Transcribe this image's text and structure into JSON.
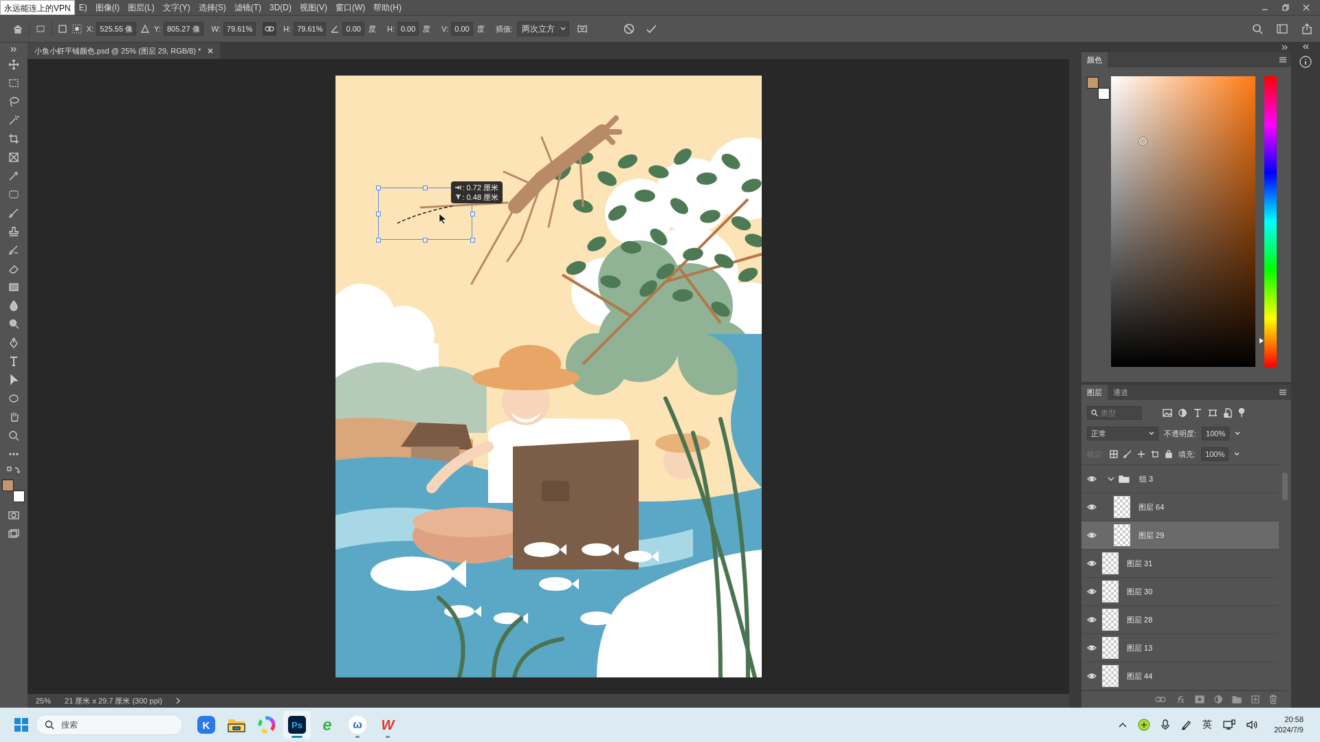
{
  "menu_bar": {
    "overlay_label": "永远能连上的VPN",
    "items": [
      "E)",
      "图像(I)",
      "图层(L)",
      "文字(Y)",
      "选择(S)",
      "滤镜(T)",
      "3D(D)",
      "视图(V)",
      "窗口(W)",
      "帮助(H)"
    ]
  },
  "options_bar": {
    "fields": [
      {
        "label": "X:",
        "value": "525.55 像"
      },
      {
        "label": "Y:",
        "value": "805.27 像"
      },
      {
        "label": "W:",
        "value": "79.61%"
      },
      {
        "label": "H:",
        "value": "79.61%"
      },
      {
        "value": "0.00",
        "unit": "度"
      },
      {
        "label": "H:",
        "value": "0.00",
        "unit": "度"
      },
      {
        "label": "V:",
        "value": "0.00",
        "unit": "度"
      }
    ],
    "proportions_linked": true,
    "interpolation": {
      "label": "插值:",
      "value": "两次立方"
    }
  },
  "document_tab": {
    "title": "小鱼小虾平铺颜色.psd @ 25% (图层 29, RGB/8) *",
    "selected": true
  },
  "canvas": {
    "measurements": [
      {
        "kind": "horizontal",
        "text": ": 0.72 厘米"
      },
      {
        "kind": "vertical",
        "text": ": 0.48 厘米"
      }
    ]
  },
  "status_bar": {
    "zoom": "25%",
    "document_size": "21 厘米 x 29.7 厘米 (300 ppi)"
  },
  "swatches": [
    {
      "kind": "foreground",
      "color": "#c4976f"
    },
    {
      "kind": "background",
      "color": "#ffffff"
    }
  ],
  "color_panel": {
    "title": "颜色",
    "hue": {
      "level": 0.09
    }
  },
  "layers_panel": {
    "tabs": [
      {
        "label": "图层",
        "selected": true
      },
      {
        "label": "通道",
        "selected": false
      }
    ],
    "filter_placeholder": "类型",
    "blend_mode": "正常",
    "opacity_label": "不透明度:",
    "opacity": "100%",
    "lock_label": "锁定:",
    "fill_label": "填充:",
    "fill": "100%",
    "layers": [
      {
        "name": "组 3",
        "kind": "group",
        "visible": true,
        "expanded": true,
        "selected": false,
        "children": [
          {
            "name": "图层 64",
            "kind": "layer",
            "visible": true,
            "selected": false
          },
          {
            "name": "图层 29",
            "kind": "layer",
            "visible": true,
            "selected": true
          }
        ]
      },
      {
        "name": "图层 31",
        "kind": "layer",
        "visible": true,
        "selected": false
      },
      {
        "name": "图层 30",
        "kind": "layer",
        "visible": true,
        "selected": false
      },
      {
        "name": "图层 28",
        "kind": "layer",
        "visible": true,
        "selected": false
      },
      {
        "name": "图层 13",
        "kind": "layer",
        "visible": true,
        "selected": false
      },
      {
        "name": "图层 44",
        "kind": "layer",
        "visible": true,
        "selected": false
      }
    ]
  },
  "taskbar": {
    "search_placeholder": "搜索",
    "apps": [
      {
        "kind": "k-app",
        "label": "K",
        "running": false,
        "active": false
      },
      {
        "kind": "folder",
        "running": false,
        "active": false
      },
      {
        "kind": "color-wheel",
        "running": false,
        "active": false
      },
      {
        "kind": "ps",
        "label": "Ps",
        "running": true,
        "active": true
      },
      {
        "kind": "e-browser",
        "label": "e",
        "running": false,
        "active": false
      },
      {
        "kind": "w-app",
        "label": "ω",
        "running": true,
        "active": false
      },
      {
        "kind": "wps",
        "label": "W",
        "running": true,
        "active": false
      }
    ],
    "input_method": "英",
    "time": "20:58",
    "date": "2024/7/9"
  }
}
